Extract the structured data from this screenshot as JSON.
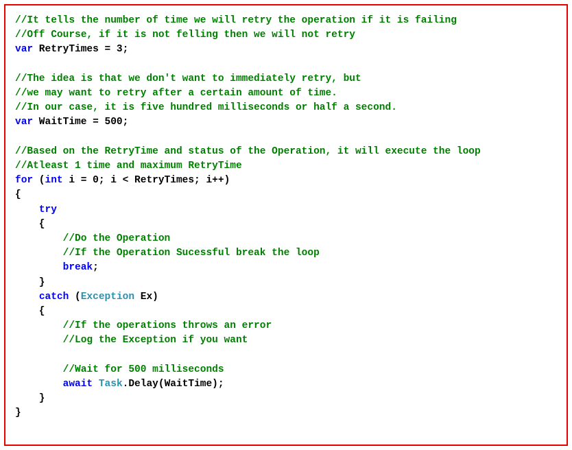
{
  "code": {
    "l1": "//It tells the number of time we will retry the operation if it is failing",
    "l2": "//Off Course, if it is not felling then we will not retry",
    "l3k": "var",
    "l3a": " RetryTimes = 3;",
    "l4": "//The idea is that we don't want to immediately retry, but",
    "l5": "//we may want to retry after a certain amount of time.",
    "l6": "//In our case, it is five hundred milliseconds or half a second.",
    "l7k": "var",
    "l7a": " WaitTime = 500;",
    "l8": "//Based on the RetryTime and status of the Operation, it will execute the loop",
    "l9": "//Atleast 1 time and maximum RetryTime",
    "l10k1": "for",
    "l10a": " (",
    "l10k2": "int",
    "l10b": " i = 0; i < RetryTimes; i++)",
    "l11": "{",
    "l12k": "try",
    "l13": "    {",
    "l14": "        //Do the Operation",
    "l15": "        //If the Operation Sucessful break the loop",
    "l16k": "break",
    "l16a": ";",
    "l17": "    }",
    "l18k": "catch",
    "l18a": " (",
    "l18t": "Exception",
    "l18b": " Ex)",
    "l19": "    {",
    "l20": "        //If the operations throws an error",
    "l21": "        //Log the Exception if you want",
    "l22": "        //Wait for 500 milliseconds",
    "l23k": "await",
    "l23a": " ",
    "l23t": "Task",
    "l23b": ".Delay(WaitTime);",
    "l24": "    }",
    "l25": "}"
  }
}
